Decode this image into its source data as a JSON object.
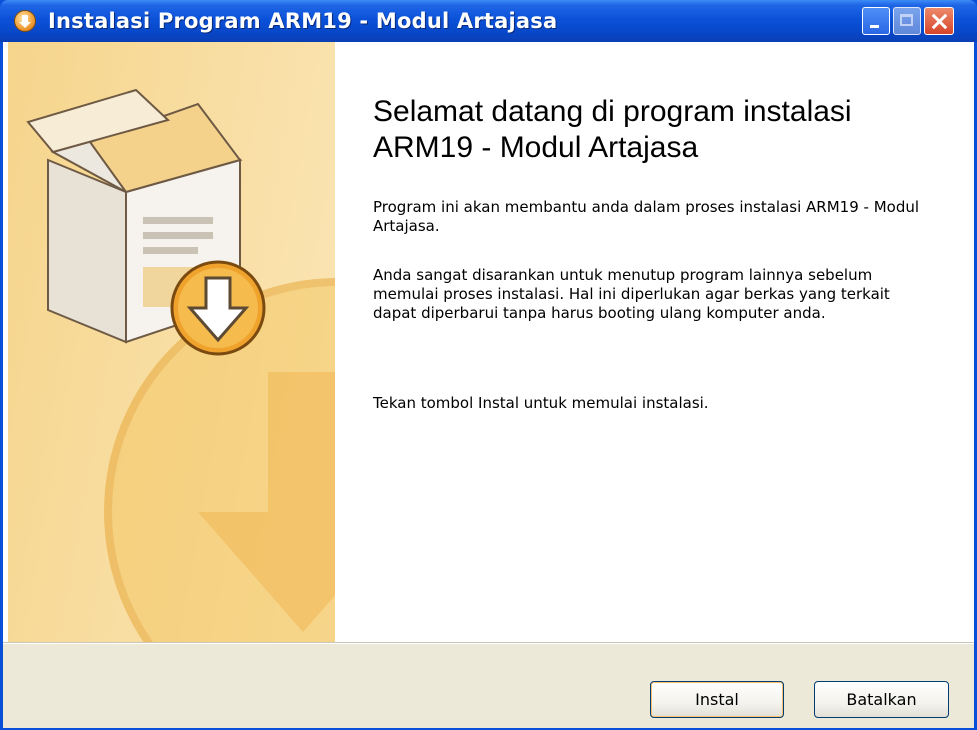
{
  "window": {
    "title": "Instalasi Program ARM19 - Modul Artajasa"
  },
  "content": {
    "heading": "Selamat datang di program instalasi ARM19 - Modul Artajasa",
    "paragraph_1": "Program ini akan membantu anda dalam proses instalasi ARM19 - Modul Artajasa.",
    "paragraph_2": "Anda sangat disarankan untuk menutup program lainnya sebelum memulai proses instalasi. Hal ini diperlukan agar berkas yang terkait dapat diperbarui tanpa harus booting ulang komputer anda.",
    "paragraph_3": "Tekan tombol Instal untuk memulai instalasi."
  },
  "buttons": {
    "install": "Instal",
    "cancel": "Batalkan"
  },
  "colors": {
    "titlebar": "#0b52d9",
    "panel": "#f8dc9e",
    "footer": "#ece9d8"
  }
}
